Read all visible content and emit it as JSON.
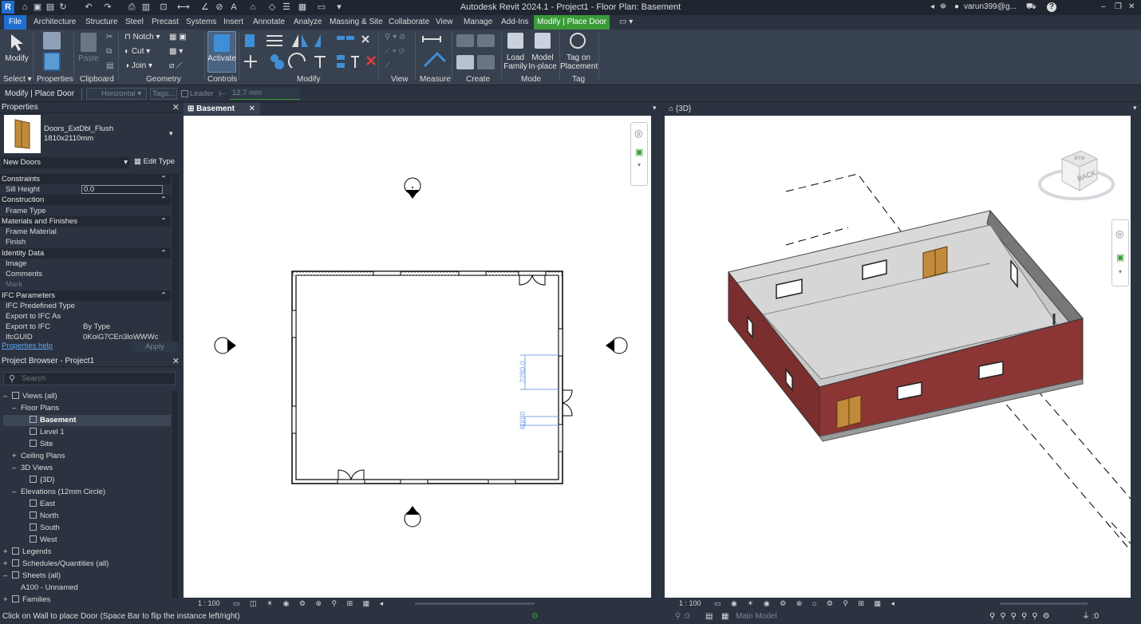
{
  "app": {
    "logo": "R",
    "window_title": "Autodesk Revit 2024.1 - Project1 - Floor Plan: Basement",
    "user": "varun399@g...",
    "help": "?",
    "window_buttons": [
      "–",
      "❐",
      "✕"
    ]
  },
  "ribbon_tabs": [
    "File",
    "Architecture",
    "Structure",
    "Steel",
    "Precast",
    "Systems",
    "Insert",
    "Annotate",
    "Analyze",
    "Massing & Site",
    "Collaborate",
    "View",
    "Manage",
    "Add-Ins",
    "Modify | Place Door"
  ],
  "ribbon": {
    "modify_label": "Modify",
    "properties_label": "Properties",
    "paste_label": "Paste",
    "notch_label": "Notch",
    "cut_label": "Cut",
    "join_label": "Join",
    "activate_label": "Activate",
    "load_family_label": "Load\nFamily",
    "model_inplace_label": "Model\nIn-place",
    "tag_on_placement_label": "Tag on\nPlacement",
    "panels": [
      "Select",
      "Properties",
      "Clipboard",
      "Geometry",
      "Controls",
      "Modify",
      "View",
      "Measure",
      "Create",
      "Mode",
      "Tag"
    ]
  },
  "options_bar": {
    "context": "Modify | Place Door",
    "orientation": "Horizontal",
    "tags_button": "Tags...",
    "leader_label": "Leader",
    "leader_length": "12.7 mm"
  },
  "properties": {
    "title": "Properties",
    "family": "Doors_ExtDbl_Flush",
    "type": "1810x2110mm",
    "filter": "New Doors",
    "edit_type": "Edit Type",
    "rows": [
      {
        "name": "Constraints",
        "group": true,
        "value": ""
      },
      {
        "name": "Sill Height",
        "group": false,
        "value": "0.0"
      },
      {
        "name": "Construction",
        "group": true,
        "value": ""
      },
      {
        "name": "Frame Type",
        "group": false,
        "value": ""
      },
      {
        "name": "Materials and Finishes",
        "group": true,
        "value": ""
      },
      {
        "name": "Frame Material",
        "group": false,
        "value": ""
      },
      {
        "name": "Finish",
        "group": false,
        "value": ""
      },
      {
        "name": "Identity Data",
        "group": true,
        "value": ""
      },
      {
        "name": "Image",
        "group": false,
        "value": ""
      },
      {
        "name": "Comments",
        "group": false,
        "value": ""
      },
      {
        "name": "Mark",
        "group": false,
        "value": ""
      },
      {
        "name": "IFC Parameters",
        "group": true,
        "value": ""
      },
      {
        "name": "IFC Predefined Type",
        "group": false,
        "value": ""
      },
      {
        "name": "Export to IFC As",
        "group": false,
        "value": ""
      },
      {
        "name": "Export to IFC",
        "group": false,
        "value": "By Type"
      },
      {
        "name": "IfcGUID",
        "group": false,
        "value": "0KoiG7CEn3loWWWc"
      }
    ],
    "help_link": "Properties help",
    "apply": "Apply"
  },
  "browser": {
    "title": "Project Browser - Project1",
    "search_placeholder": "Search",
    "items": [
      {
        "label": "Views (all)",
        "expander": "–",
        "selected": false
      },
      {
        "label": "Floor Plans",
        "expander": "–",
        "selected": false
      },
      {
        "label": "Basement",
        "expander": "",
        "selected": true
      },
      {
        "label": "Level 1",
        "expander": "",
        "selected": false
      },
      {
        "label": "Site",
        "expander": "",
        "selected": false
      },
      {
        "label": "Ceiling Plans",
        "expander": "+",
        "selected": false
      },
      {
        "label": "3D Views",
        "expander": "–",
        "selected": false
      },
      {
        "label": "{3D}",
        "expander": "",
        "selected": false
      },
      {
        "label": "Elevations (12mm Circle)",
        "expander": "–",
        "selected": false
      },
      {
        "label": "East",
        "expander": "",
        "selected": false
      },
      {
        "label": "North",
        "expander": "",
        "selected": false
      },
      {
        "label": "South",
        "expander": "",
        "selected": false
      },
      {
        "label": "West",
        "expander": "",
        "selected": false
      },
      {
        "label": "Legends",
        "expander": "+",
        "selected": false
      },
      {
        "label": "Schedules/Quantities (all)",
        "expander": "+",
        "selected": false
      },
      {
        "label": "Sheets (all)",
        "expander": "–",
        "selected": false
      },
      {
        "label": "A100 - Unnamed",
        "expander": "",
        "selected": false
      },
      {
        "label": "Families",
        "expander": "+",
        "selected": false
      }
    ]
  },
  "views": {
    "plan_tab": "Basement",
    "threed_tab": "{3D}",
    "plan_scale": "1 : 100",
    "threed_scale": "1 : 100",
    "dim_1": "2280.0",
    "dim_2": "600.0",
    "viewcube_face": "BACK",
    "viewcube_top": "BTM"
  },
  "status": {
    "message": "Click on Wall to place Door (Space Bar to flip the instance left/right)",
    "worksets": ":0",
    "model": "Main Model",
    "filter": ":0"
  }
}
